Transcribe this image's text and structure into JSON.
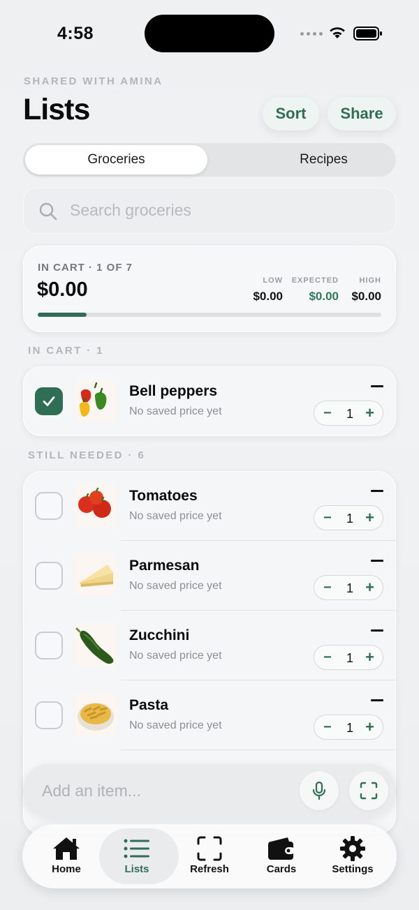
{
  "status_bar": {
    "time": "4:58"
  },
  "header": {
    "eyebrow": "SHARED WITH AMINA",
    "title": "Lists",
    "sort_label": "Sort",
    "share_label": "Share"
  },
  "tabs": [
    "Groceries",
    "Recipes"
  ],
  "active_tab": "Groceries",
  "search": {
    "placeholder": "Search groceries"
  },
  "summary": {
    "label": "IN CART · 1 OF 7",
    "total": "$0.00",
    "low_label": "LOW",
    "low_value": "$0.00",
    "expected_label": "EXPECTED",
    "expected_value": "$0.00",
    "high_label": "HIGH",
    "high_value": "$0.00",
    "progress_fraction": 0.143
  },
  "in_cart": {
    "header": "IN CART · 1",
    "items": [
      {
        "name": "Bell peppers",
        "price": "No saved price yet",
        "qty": "1",
        "checked": true
      }
    ]
  },
  "still_needed": {
    "header": "STILL NEEDED · 6",
    "items": [
      {
        "name": "Tomatoes",
        "price": "No saved price yet",
        "qty": "1",
        "checked": false
      },
      {
        "name": "Parmesan",
        "price": "No saved price yet",
        "qty": "1",
        "checked": false
      },
      {
        "name": "Zucchini",
        "price": "No saved price yet",
        "qty": "1",
        "checked": false
      },
      {
        "name": "Pasta",
        "price": "No saved price yet",
        "qty": "1",
        "checked": false
      }
    ]
  },
  "stepper": {
    "minus": "−",
    "plus": "+"
  },
  "add_item": {
    "placeholder": "Add an item..."
  },
  "tab_bar": [
    {
      "label": "Home",
      "icon": "house-icon"
    },
    {
      "label": "Lists",
      "icon": "list-icon",
      "active": true
    },
    {
      "label": "Refresh",
      "icon": "scan-frame-icon"
    },
    {
      "label": "Cards",
      "icon": "wallet-icon"
    },
    {
      "label": "Settings",
      "icon": "gear-icon"
    }
  ],
  "colors": {
    "accent": "#2f6e55",
    "expected_value": "#2f7a5b"
  }
}
